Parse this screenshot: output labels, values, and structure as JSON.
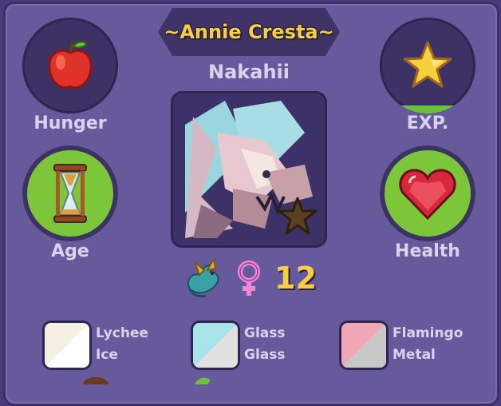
{
  "pet": {
    "name": "~Annie Cresta~",
    "species": "Nakahii",
    "level": "12"
  },
  "stats": {
    "hunger_label": "Hunger",
    "exp_label": "EXP.",
    "age_label": "Age",
    "health_label": "Health",
    "exp_progress_fraction": 0.08
  },
  "colors": [
    {
      "line1": "Lychee",
      "line2": "Ice",
      "swatch_a": "#f6f0e2",
      "swatch_b": "#ffffff"
    },
    {
      "line1": "Glass",
      "line2": "Glass",
      "swatch_a": "#a9e3ea",
      "swatch_b": "#e1e1e1"
    },
    {
      "line1": "Flamingo",
      "line2": "Metal",
      "swatch_a": "#f0a7b5",
      "swatch_b": "#c8c8c8"
    }
  ],
  "icons": {
    "hunger": "apple-icon",
    "exp": "star-icon",
    "age": "hourglass-icon",
    "health": "heart-gem-icon",
    "element": "dragon-icon",
    "gender": "female-icon",
    "badge": "dark-star-icon"
  }
}
